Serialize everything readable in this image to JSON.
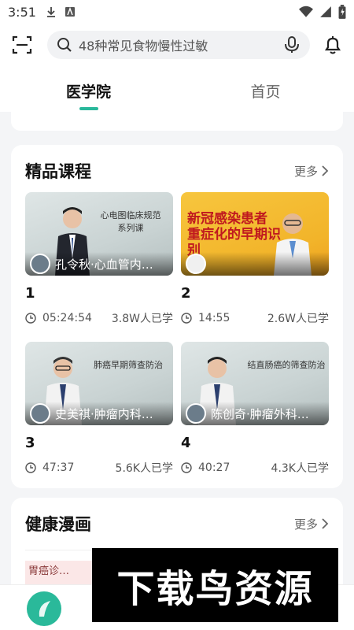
{
  "status_bar": {
    "time": "3:51",
    "icons_left": [
      "download-icon",
      "app-notification-icon"
    ],
    "icons_right": [
      "wifi-icon",
      "signal-icon",
      "battery-icon"
    ]
  },
  "search": {
    "placeholder": "48种常见食物慢性过敏"
  },
  "tabs": [
    {
      "label": "医学院",
      "active": true
    },
    {
      "label": "首页",
      "active": false
    }
  ],
  "courses_section": {
    "title": "精品课程",
    "more_label": "更多",
    "items": [
      {
        "number": "1",
        "slide_title": "心电图临床规范\n系列课",
        "overlay": "孔令秋·心血管内…",
        "duration": "05:24:54",
        "learners": "3.8W人已学"
      },
      {
        "number": "2",
        "slide_title": "新冠感染患者\n重症化的早期识别",
        "overlay": "",
        "duration": "14:55",
        "learners": "2.6W人已学"
      },
      {
        "number": "3",
        "slide_title": "肺癌早期筛查防治",
        "overlay": "史美祺·肿瘤内科…",
        "duration": "47:37",
        "learners": "5.6K人已学"
      },
      {
        "number": "4",
        "slide_title": "结直肠癌的筛查防治",
        "overlay": "陈创奇·肿瘤外科…",
        "duration": "40:27",
        "learners": "4.3K人已学"
      }
    ]
  },
  "comics_section": {
    "title": "健康漫画",
    "more_label": "更多",
    "preview_text": "胃癌诊…"
  },
  "watermark": {
    "text": "下载鸟资源"
  },
  "colors": {
    "accent": "#29b89b",
    "background": "#f4f5f7"
  }
}
